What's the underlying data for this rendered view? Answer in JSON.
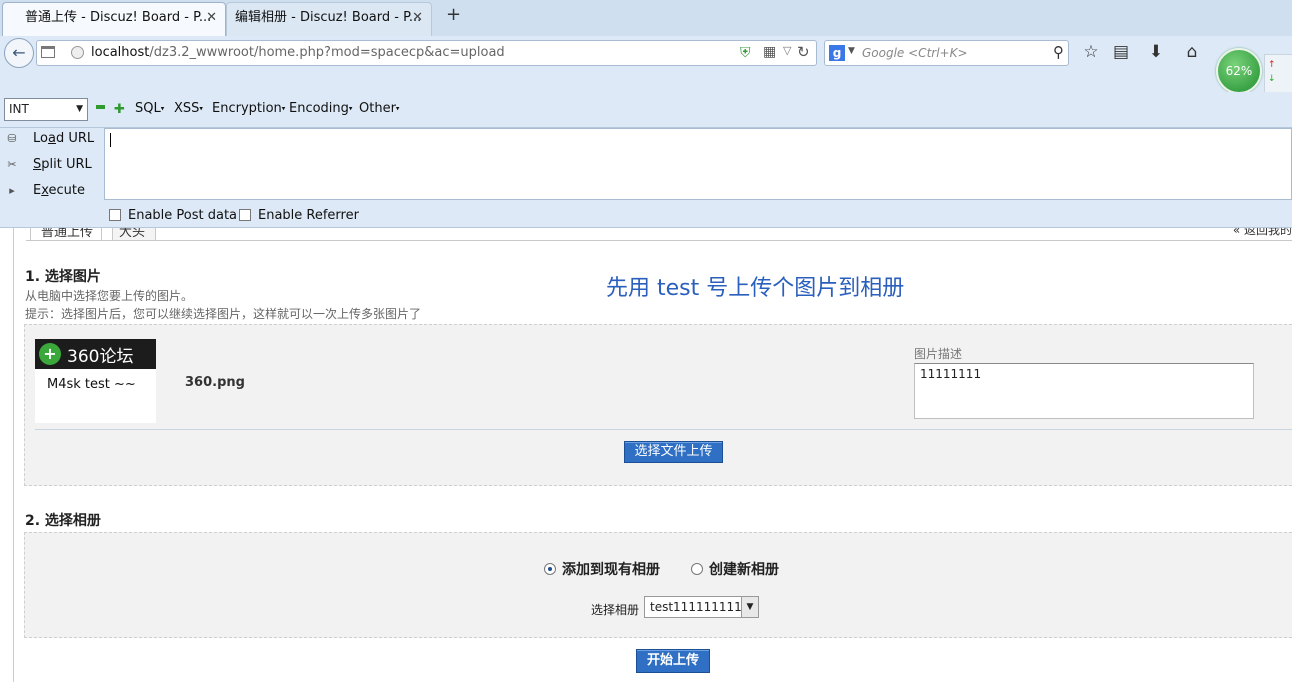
{
  "browser": {
    "tabs": [
      {
        "label": "普通上传 - Discuz! Board - P...",
        "active": true
      },
      {
        "label": "编辑相册 - Discuz! Board - P...",
        "active": false
      }
    ],
    "new_tab": "+",
    "url_host": "localhost",
    "url_path": "/dz3.2_wwwroot/home.php?mod=spacecp&ac=upload",
    "search_engine": "g",
    "search_placeholder": "Google <Ctrl+K>",
    "speed_percent": "62%"
  },
  "hackbar": {
    "select_value": "INT",
    "menus": [
      "SQL",
      "XSS",
      "Encryption",
      "Encoding",
      "Other"
    ],
    "actions": {
      "load": {
        "pre": "Lo",
        "key": "a",
        "post": "d URL"
      },
      "split": {
        "pre": "",
        "key": "S",
        "post": "plit URL"
      },
      "execute": {
        "pre": "E",
        "key": "x",
        "post": "ecute"
      }
    },
    "url_text": "",
    "options": {
      "post_data": "Enable Post data",
      "referrer": "Enable Referrer"
    }
  },
  "page": {
    "tabs": {
      "current": "普通上传",
      "other": "大头贴",
      "back": "« 返回我的"
    },
    "section1": {
      "title": "1. 选择图片",
      "hint1": "从电脑中选择您要上传的图片。",
      "hint2": "提示：选择图片后，您可以继续选择图片，这样就可以一次上传多张图片了"
    },
    "annotation": "先用 test 号上传个图片到相册",
    "upload": {
      "logo_text": "360论坛",
      "thumb_caption": "M4sk test ~~",
      "file_name": "360.png",
      "desc_label": "图片描述",
      "desc_value": "11111111",
      "choose_button": "选择文件上传"
    },
    "section2": {
      "title": "2. 选择相册",
      "radio_existing": "添加到现有相册",
      "radio_new": "创建新相册",
      "album_label": "选择相册",
      "album_value": "test111111111"
    },
    "start_button": "开始上传"
  }
}
